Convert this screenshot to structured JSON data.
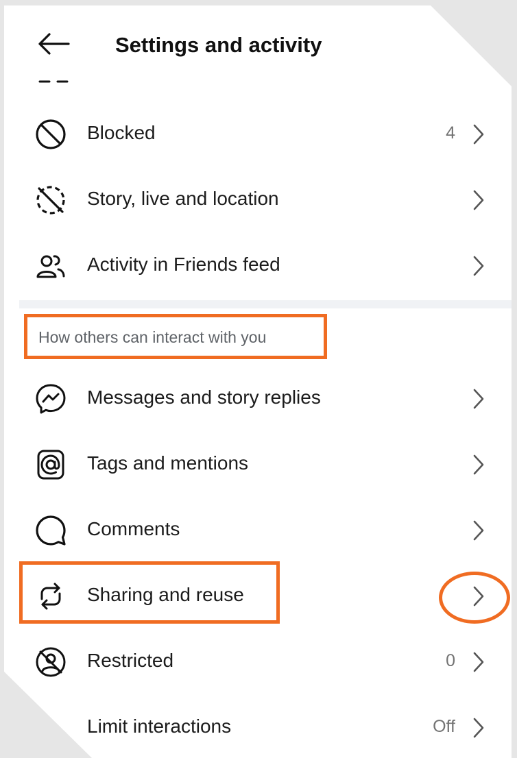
{
  "header": {
    "title": "Settings and activity"
  },
  "rows_top": [
    {
      "label": "Blocked",
      "meta": "4"
    },
    {
      "label": "Story, live and location",
      "meta": ""
    },
    {
      "label": "Activity in Friends feed",
      "meta": ""
    }
  ],
  "section": {
    "title": "How others can interact with you"
  },
  "rows_bottom": [
    {
      "label": "Messages and story replies",
      "meta": ""
    },
    {
      "label": "Tags and mentions",
      "meta": ""
    },
    {
      "label": "Comments",
      "meta": ""
    },
    {
      "label": "Sharing and reuse",
      "meta": ""
    },
    {
      "label": "Restricted",
      "meta": "0"
    },
    {
      "label": "Limit interactions",
      "meta": "Off"
    }
  ],
  "annotation": {
    "color": "#f06c22"
  }
}
